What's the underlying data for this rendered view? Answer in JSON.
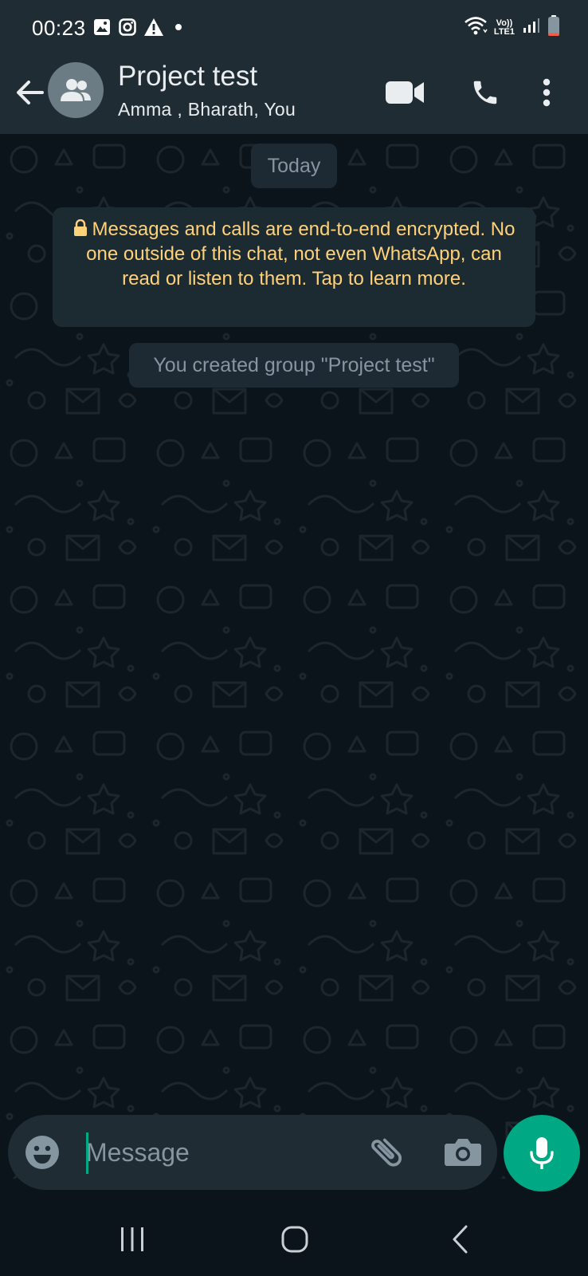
{
  "status_bar": {
    "time": "00:23",
    "left_icons": [
      "gallery-notification-icon",
      "instagram-notification-icon",
      "warning-icon",
      "dot-icon"
    ],
    "volte_line1": "Vo))",
    "volte_line2": "LTE1",
    "right_icons": [
      "wifi-icon",
      "volte-icon",
      "signal-icon",
      "battery-icon"
    ],
    "battery_level": 0.15
  },
  "header": {
    "title": "Project test",
    "subtitle": "Amma , Bharath, You",
    "actions": [
      "video-call-icon",
      "voice-call-icon",
      "more-options-icon"
    ]
  },
  "chat": {
    "date_chip": "Today",
    "encryption_notice": "Messages and calls are end-to-end encrypted. No one outside of this chat, not even WhatsApp, can read or listen to them. Tap to learn more.",
    "system_message": "You created group \"Project test\""
  },
  "composer": {
    "placeholder": "Message",
    "value": "",
    "icons": [
      "emoji-icon",
      "attachment-icon",
      "camera-icon",
      "microphone-icon"
    ]
  },
  "nav_bar": {
    "buttons": [
      "recent-apps-icon",
      "home-icon",
      "back-icon"
    ]
  },
  "colors": {
    "header_bg": "#1f2c34",
    "chat_bg": "#0b141a",
    "accent": "#00a884",
    "notice_text": "#ffd279",
    "muted_text": "#8696a0"
  }
}
